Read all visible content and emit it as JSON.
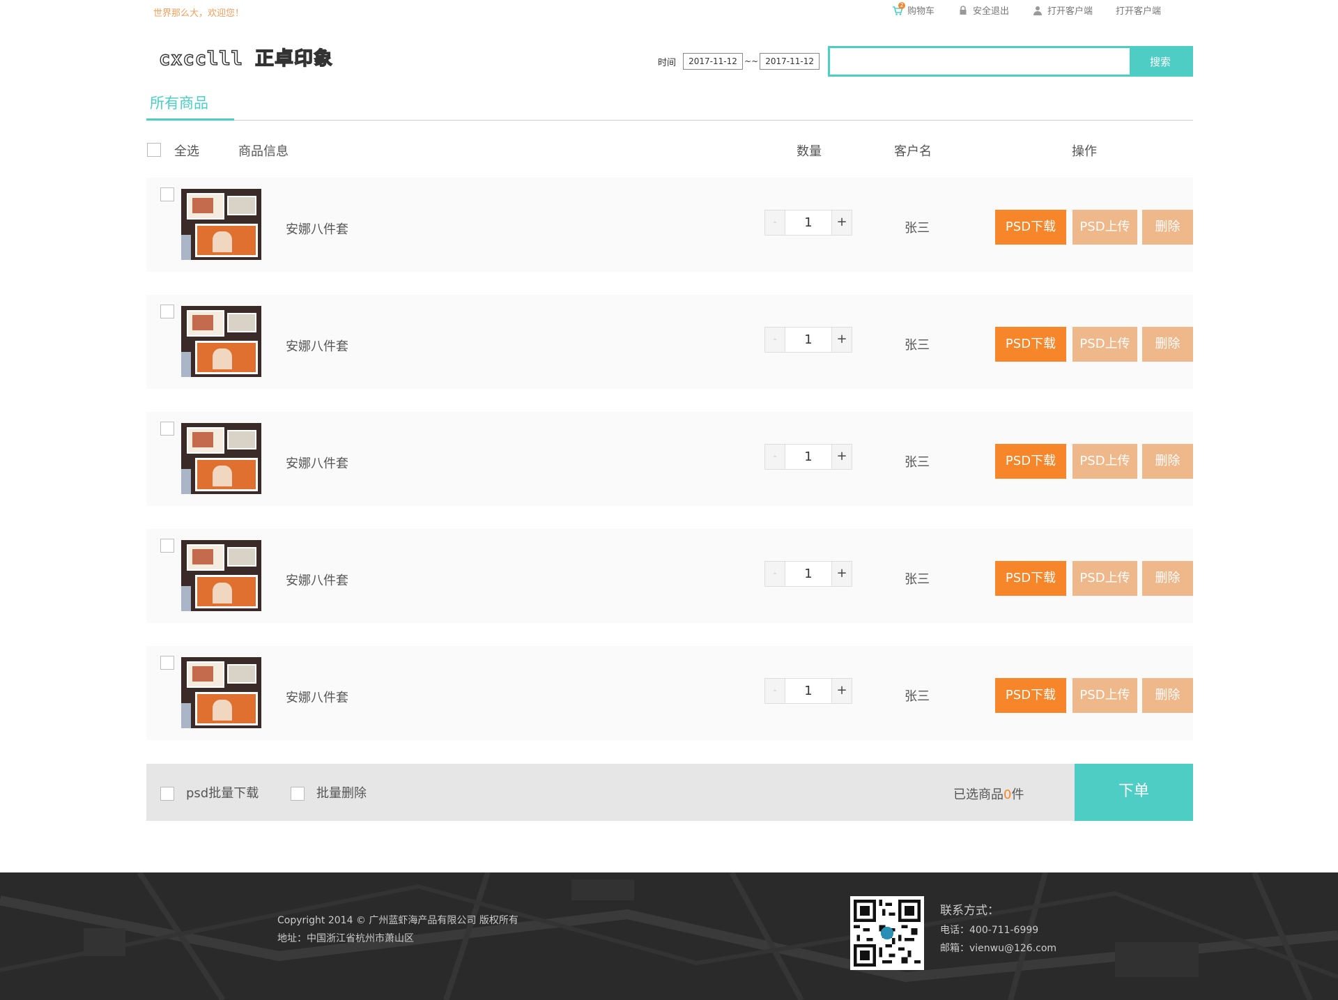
{
  "topbar": {
    "welcome": "世界那么大，欢迎您！",
    "cart_count": "2",
    "links": [
      "购物车",
      "安全退出",
      "打开客户端",
      "打开客户端"
    ]
  },
  "header": {
    "logo": "cxcclll 正卓印象",
    "time_label": "时间",
    "date_from": "2017-11-12",
    "date_sep": "~~",
    "date_to": "2017-11-12",
    "search_value": "",
    "search_button": "搜索"
  },
  "tab": {
    "label": "所有商品"
  },
  "columns": {
    "select_all": "全选",
    "info": "商品信息",
    "qty": "数量",
    "customer": "客户名",
    "ops": "操作"
  },
  "rows": [
    {
      "name": "安娜八件套",
      "qty": "1",
      "customer": "张三"
    },
    {
      "name": "安娜八件套",
      "qty": "1",
      "customer": "张三"
    },
    {
      "name": "安娜八件套",
      "qty": "1",
      "customer": "张三"
    },
    {
      "name": "安娜八件套",
      "qty": "1",
      "customer": "张三"
    },
    {
      "name": "安娜八件套",
      "qty": "1",
      "customer": "张三"
    }
  ],
  "row_buttons": {
    "download": "PSD下载",
    "upload": "PSD上传",
    "delete": "删除",
    "minus": "-",
    "plus": "+"
  },
  "bar": {
    "batch_download": "psd批量下载",
    "batch_delete": "批量删除",
    "selected_prefix": "已选商品",
    "selected_count": "0",
    "selected_suffix": "件",
    "order_button": "下单"
  },
  "footer": {
    "copyright": "Copyright 2014 © 广州蓝虾海产品有限公司 版权所有",
    "address": "地址：中国浙江省杭州市萧山区",
    "contact_title": "联系方式：",
    "phone": "电话：400-711-6999",
    "email": "邮箱：vienwu@126.com"
  },
  "colors": {
    "accent": "#4ecdc4",
    "orange": "#f7862a",
    "light_orange": "#efb88b"
  }
}
